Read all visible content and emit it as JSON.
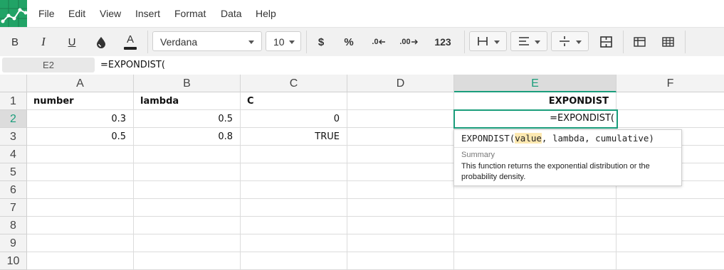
{
  "menu": [
    "File",
    "Edit",
    "View",
    "Insert",
    "Format",
    "Data",
    "Help"
  ],
  "toolbar": {
    "bold": "B",
    "italic": "I",
    "underline": "U",
    "text_color": "A",
    "font_name": "Verdana",
    "font_size": "10",
    "currency": "$",
    "percent": "%",
    "dec_decrease": ".0",
    "dec_increase": ".00",
    "number_format": "123"
  },
  "formula_bar": {
    "cell_ref": "E2",
    "formula": "=EXPONDIST("
  },
  "columns": [
    "A",
    "B",
    "C",
    "D",
    "E",
    "F"
  ],
  "selected_column": "E",
  "rows": [
    "1",
    "2",
    "3",
    "4",
    "5",
    "6",
    "7",
    "8",
    "9",
    "10"
  ],
  "selected_row": "2",
  "cells": {
    "A1": "number",
    "B1": "lambda",
    "C1": "C",
    "E1": "EXPONDIST",
    "A2": "0.3",
    "B2": "0.5",
    "C2": "0",
    "A3": "0.5",
    "B3": "0.8",
    "C3": "TRUE",
    "E2": "=EXPONDIST("
  },
  "tooltip": {
    "fn": "EXPONDIST(",
    "arg_active": "value",
    "rest": ", lambda, cumulative)",
    "summary_heading": "Summary",
    "summary_text": "This function returns the exponential distribution or the probability density."
  },
  "colors": {
    "accent": "#1a9d7b",
    "logo": "#21a366",
    "highlight": "#fde8b0"
  },
  "icons": [
    "spreadsheet-logo",
    "fill-color-icon",
    "borders-icon",
    "align-icon",
    "valign-icon",
    "merge-icon",
    "freeze-icon",
    "grid-icon"
  ]
}
